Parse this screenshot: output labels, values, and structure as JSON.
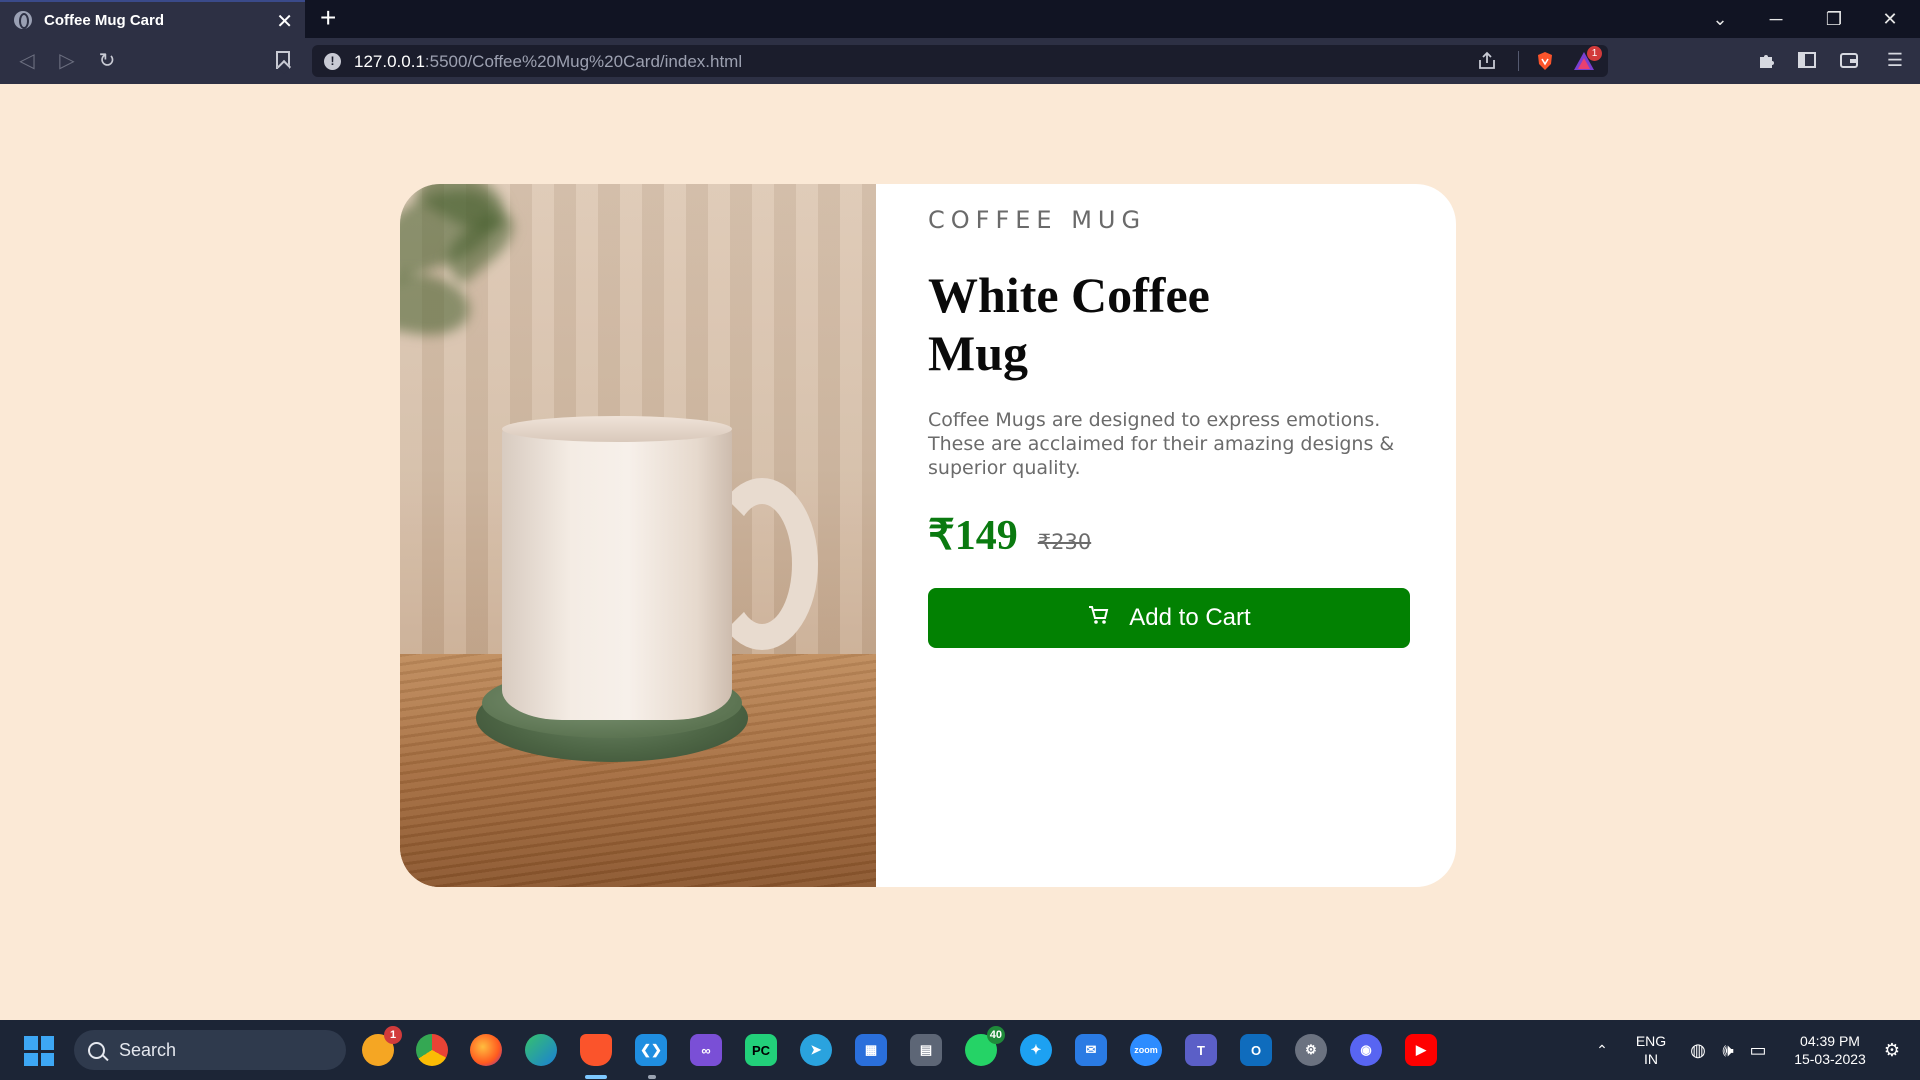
{
  "browser": {
    "tab_title": "Coffee Mug Card",
    "tab_close": "✕",
    "new_tab": "+",
    "url_host": "127.0.0.1",
    "url_rest": ":5500/Coffee%20Mug%20Card/index.html",
    "shield_badge": "1"
  },
  "card": {
    "category": "COFFEE MUG",
    "title": "White Coffee Mug",
    "description": "Coffee Mugs are designed to express emotions. These are acclaimed for their amazing designs & superior quality.",
    "price": "₹149",
    "old_price": "₹230",
    "button_label": "Add to Cart",
    "accent_color": "#028102",
    "background_color": "#fbe9d6"
  },
  "taskbar": {
    "search_label": "Search",
    "weather_badge": "1",
    "whatsapp_badge": "40",
    "language_line1": "ENG",
    "language_line2": "IN",
    "time": "04:39 PM",
    "date": "15-03-2023"
  }
}
